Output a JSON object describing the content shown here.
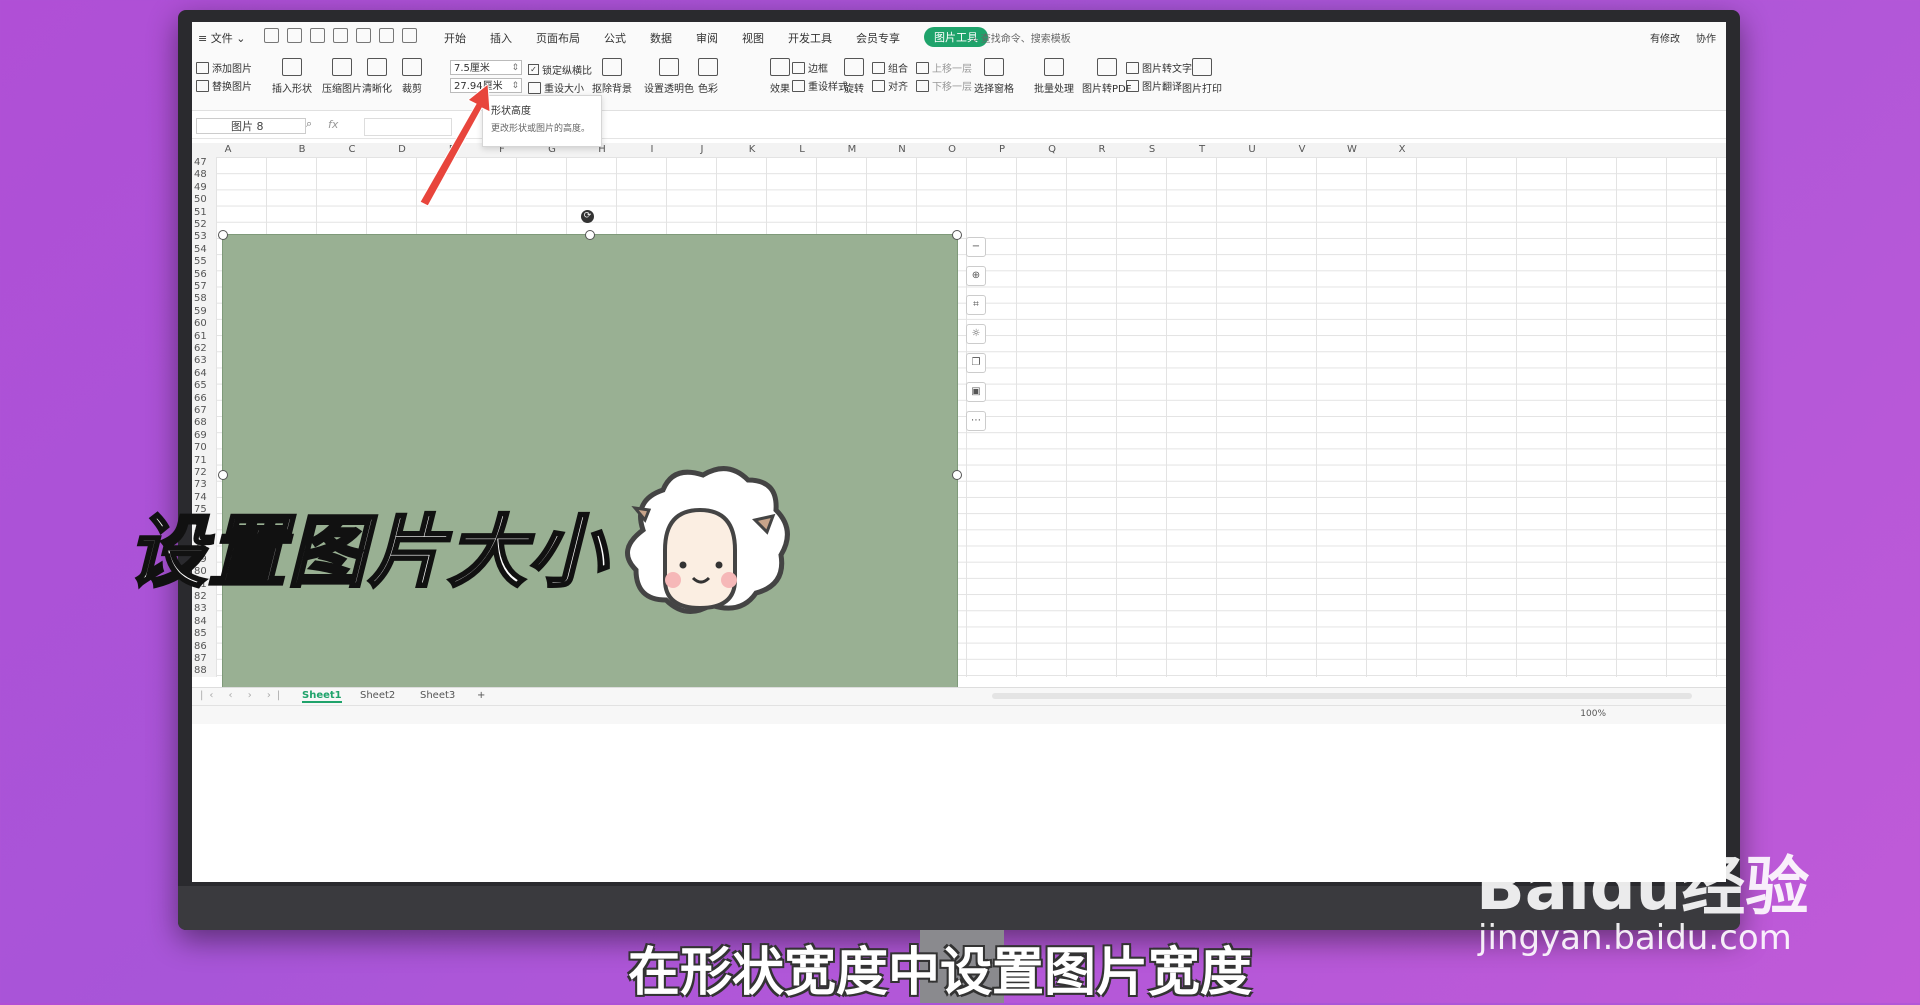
{
  "tabbar": {
    "file_menu": "≡ 文件 ⌄",
    "tabs": [
      "开始",
      "插入",
      "页面布局",
      "公式",
      "数据",
      "审阅",
      "视图",
      "开发工具",
      "会员专享"
    ],
    "active_tab": "图片工具",
    "search": "查找命令、搜索模板",
    "modified": "有修改",
    "collaborate": "协作"
  },
  "ribbon": {
    "add_picture": "添加图片",
    "replace_picture": "替换图片",
    "insert_shape": "插入形状",
    "compress_picture": "压缩图片",
    "sharpen": "清晰化",
    "crop": "裁剪",
    "height_value": "7.5厘米",
    "width_value": "27.94厘米",
    "lock_ratio": "锁定纵横比",
    "reset_size": "重设大小",
    "remove_background": "抠除背景",
    "set_transparent": "设置透明色",
    "color": "色彩",
    "effects": "效果",
    "border": "边框",
    "reset_style": "重设样式",
    "rotate": "旋转",
    "group": "组合",
    "align": "对齐",
    "bring_forward": "上移一层",
    "send_backward": "下移一层",
    "selection_pane": "选择窗格",
    "batch_process": "批量处理",
    "to_pdf": "图片转PDF",
    "to_text": "图片转文字",
    "translate": "图片翻译",
    "print": "图片打印"
  },
  "tooltip": {
    "title": "形状高度",
    "desc": "更改形状或图片的高度。"
  },
  "formula_bar": {
    "name_box": "图片 8",
    "fx": "fx"
  },
  "columns": [
    "A",
    "B",
    "C",
    "D",
    "E",
    "F",
    "G",
    "H",
    "I",
    "J",
    "K",
    "L",
    "M",
    "N",
    "O",
    "P",
    "Q",
    "R",
    "S",
    "T",
    "U",
    "V",
    "W",
    "X"
  ],
  "rows": [
    "47",
    "48",
    "49",
    "50",
    "51",
    "52",
    "53",
    "54",
    "55",
    "56",
    "57",
    "58",
    "59",
    "60",
    "61",
    "62",
    "63",
    "64",
    "65",
    "66",
    "67",
    "68",
    "69",
    "70",
    "71",
    "72",
    "73",
    "74",
    "75",
    "76",
    "77",
    "78",
    "79",
    "80",
    "81",
    "82",
    "83",
    "84",
    "85",
    "86",
    "87",
    "88"
  ],
  "sheets": [
    "Sheet1",
    "Sheet2",
    "Sheet3"
  ],
  "add_sheet": "+",
  "status": {
    "zoom": "100%"
  },
  "overlay": {
    "caption": "设置图片大小",
    "subtitle": "在形状宽度中设置图片宽度",
    "watermark": "Baidu经验",
    "watermark_url": "jingyan.baidu.com"
  },
  "colors": {
    "accent": "#1fa36b",
    "picture_bg": "#99b093",
    "arrow": "#e8453c"
  }
}
